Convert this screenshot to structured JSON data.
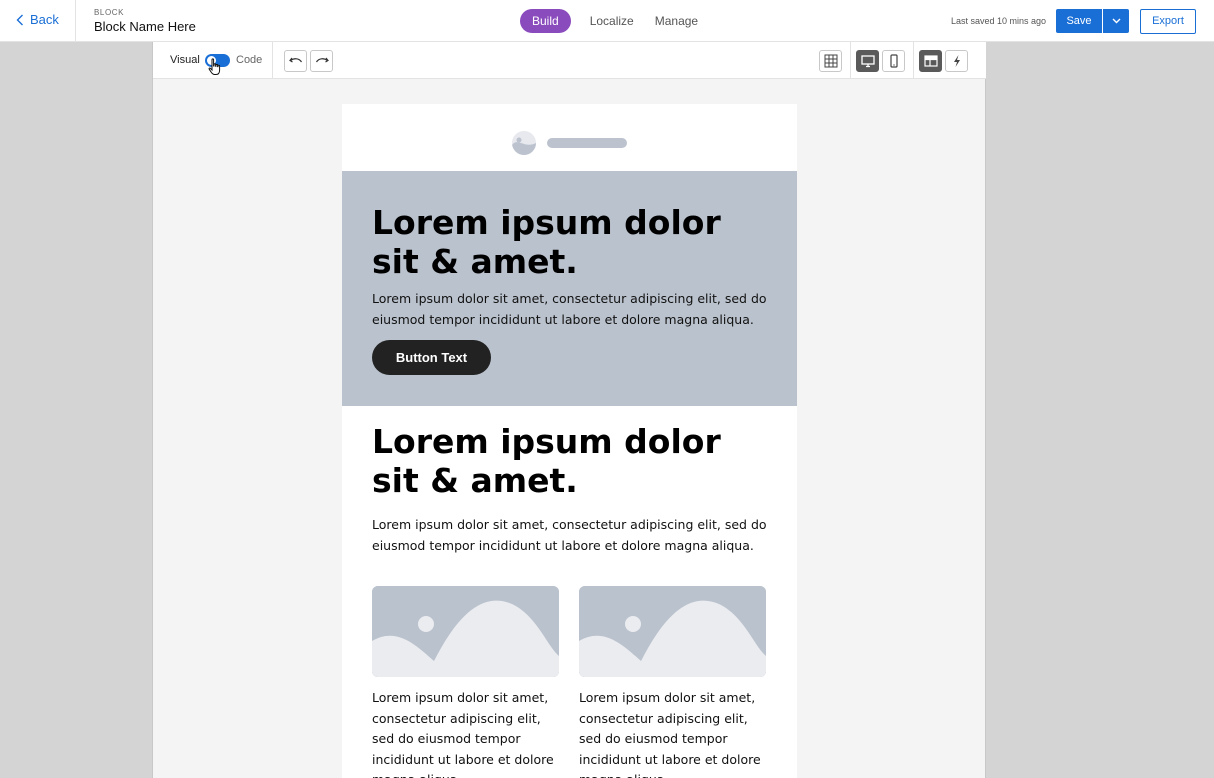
{
  "header": {
    "back_label": "Back",
    "kicker": "BLOCK",
    "block_name": "Block Name Here",
    "tabs": [
      "Build",
      "Localize",
      "Manage"
    ],
    "active_tab": "Build",
    "last_saved": "Last saved 10 mins ago",
    "save_label": "Save",
    "export_label": "Export"
  },
  "toolbar": {
    "visual_label": "Visual",
    "code_label": "Code",
    "mode": "visual",
    "icons": [
      "undo-icon",
      "redo-icon",
      "grid-icon",
      "desktop-icon",
      "mobile-icon",
      "layout-icon",
      "lightning-icon"
    ]
  },
  "email": {
    "hero": {
      "headline": "Lorem ipsum dolor sit & amet.",
      "body": "Lorem ipsum dolor sit amet, consectetur adipiscing elit, sed do eiusmod tempor incididunt ut labore et dolore magna aliqua.",
      "button_text": "Button Text"
    },
    "section": {
      "headline": "Lorem ipsum dolor sit & amet.",
      "body": "Lorem ipsum dolor sit amet, consectetur adipiscing elit, sed do eiusmod tempor incididunt ut labore et dolore magna aliqua."
    },
    "columns": [
      {
        "text": "Lorem ipsum dolor sit amet, consectetur adipiscing elit, sed do eiusmod tempor incididunt ut labore et dolore magna aliqua."
      },
      {
        "text": "Lorem ipsum dolor sit amet, consectetur adipiscing elit, sed do eiusmod tempor incididunt ut labore et dolore magna aliqua."
      }
    ]
  },
  "colors": {
    "accent_blue": "#1a6fd6",
    "build_purple": "#8a4bbd",
    "hero_bg": "#bac2cd",
    "button_dark": "#222222"
  }
}
